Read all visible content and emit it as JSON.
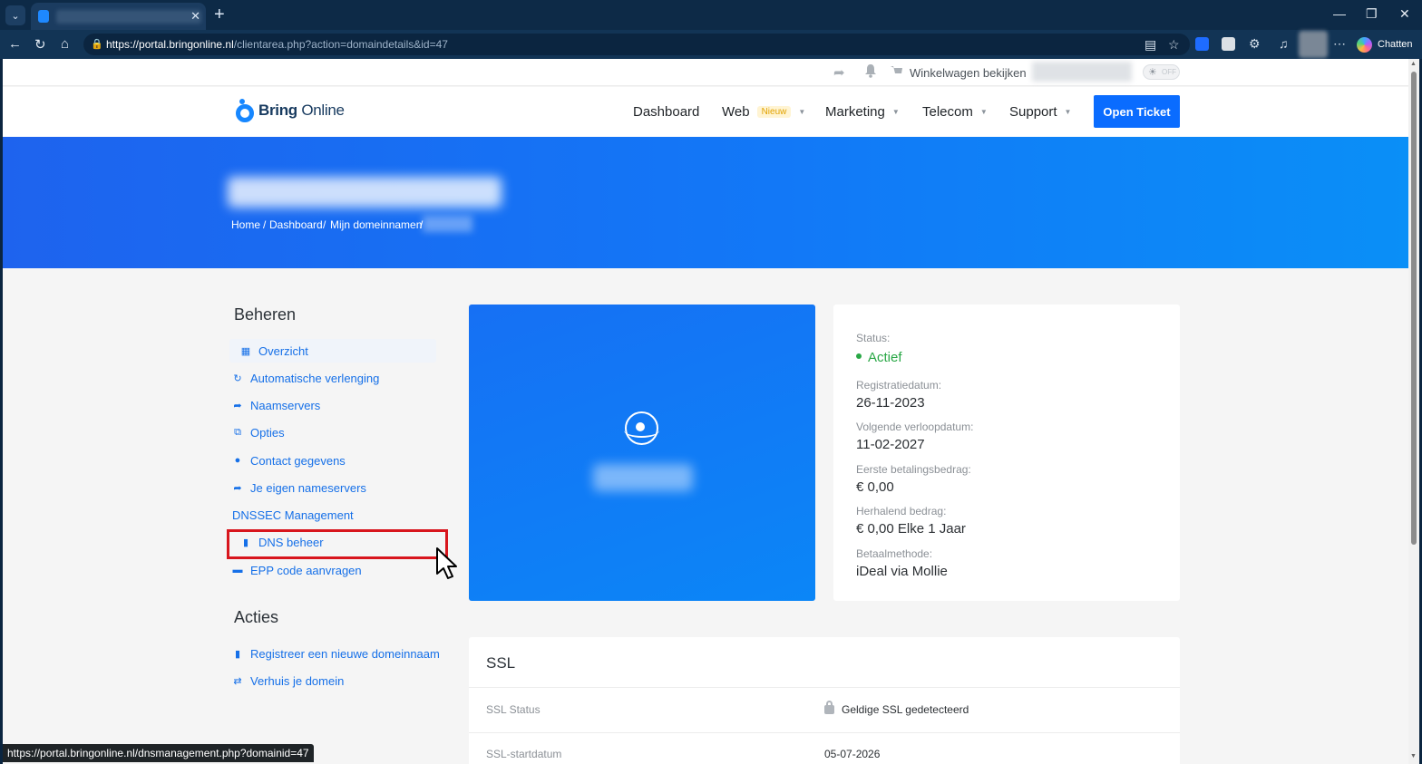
{
  "browser": {
    "url_domain": "https://portal.bringonline.nl",
    "url_path": "/clientarea.php?action=domaindetails&id=47",
    "chat_label": "Chatten",
    "status_url": "https://portal.bringonline.nl/dnsmanagement.php?domainid=47"
  },
  "topbar": {
    "cart_label": "Winkelwagen bekijken",
    "toggle_label": "OFF"
  },
  "brand": {
    "name_bold": "Bring",
    "name_light": "Online",
    "accent_color": "#1787ff"
  },
  "nav": {
    "items": [
      {
        "label": "Dashboard"
      },
      {
        "label": "Web",
        "badge": "Nieuw"
      },
      {
        "label": "Marketing"
      },
      {
        "label": "Telecom"
      },
      {
        "label": "Support"
      }
    ],
    "cta": "Open Ticket"
  },
  "breadcrumb": [
    "Home",
    "Dashboard",
    "Mijn domeinnamen"
  ],
  "sidebar": {
    "manage_heading": "Beheren",
    "manage_items": [
      {
        "label": "Overzicht",
        "icon": "dashboard-icon"
      },
      {
        "label": "Automatische verlenging",
        "icon": "sync-icon"
      },
      {
        "label": "Naamservers",
        "icon": "share-arrow-icon"
      },
      {
        "label": "Opties",
        "icon": "clone-icon"
      },
      {
        "label": "Contact gegevens",
        "icon": "user-icon"
      },
      {
        "label": "Je eigen nameservers",
        "icon": "share-arrow-icon"
      },
      {
        "label": "DNSSEC Management"
      },
      {
        "label": "DNS beheer",
        "icon": "tag-icon"
      },
      {
        "label": "EPP code aanvragen",
        "icon": "credit-card-icon"
      }
    ],
    "actions_heading": "Acties",
    "action_items": [
      {
        "label": "Registreer een nieuwe domeinnaam",
        "icon": "tag-icon"
      },
      {
        "label": "Verhuis je domein",
        "icon": "transfer-icon"
      }
    ]
  },
  "domain_info": {
    "status_label": "Status:",
    "status_value": "Actief",
    "status_color": "#28a745",
    "registration_label": "Registratiedatum:",
    "registration_value": "26-11-2023",
    "next_due_label": "Volgende verloopdatum:",
    "next_due_value": "11-02-2027",
    "first_payment_label": "Eerste betalingsbedrag:",
    "first_payment_value": "€ 0,00",
    "recurring_label": "Herhalend bedrag:",
    "recurring_value": "€ 0,00 Elke 1 Jaar",
    "payment_method_label": "Betaalmethode:",
    "payment_method_value": "iDeal via Mollie"
  },
  "ssl": {
    "title": "SSL",
    "status_label": "SSL Status",
    "status_value": "Geldige SSL gedetecteerd",
    "start_label": "SSL-startdatum",
    "start_value": "05-07-2026"
  }
}
